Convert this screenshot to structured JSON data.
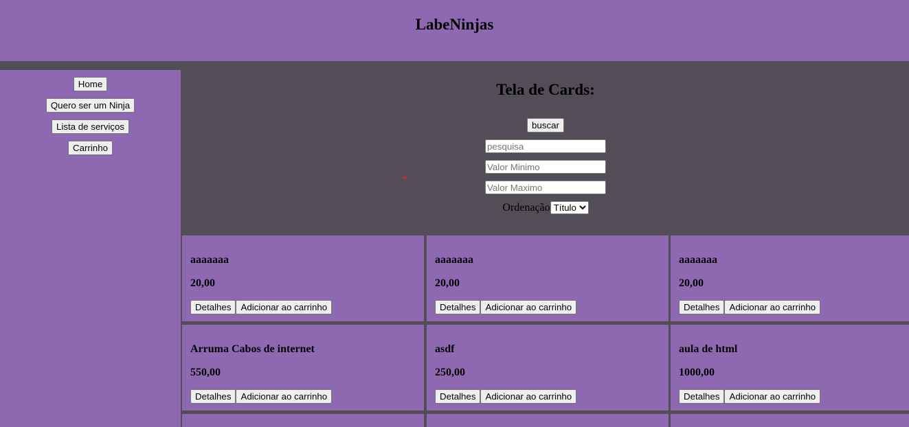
{
  "app": {
    "title": "LabeNinjas"
  },
  "sidebar": {
    "items": [
      {
        "label": "Home"
      },
      {
        "label": "Quero ser um Ninja"
      },
      {
        "label": "Lista de serviços"
      },
      {
        "label": "Carrinho"
      }
    ]
  },
  "filter": {
    "heading": "Tela de Cards:",
    "search_button": "buscar",
    "search_placeholder": "pesquisa",
    "min_placeholder": "Valor Minimo",
    "max_placeholder": "Valor Maximo",
    "sort_label": "Ordenação",
    "sort_selected": "Título"
  },
  "cards": [
    {
      "title": "aaaaaaa",
      "price": "20,00",
      "details_label": "Detalhes",
      "add_label": "Adicionar ao carrinho"
    },
    {
      "title": "aaaaaaa",
      "price": "20,00",
      "details_label": "Detalhes",
      "add_label": "Adicionar ao carrinho"
    },
    {
      "title": "aaaaaaa",
      "price": "20,00",
      "details_label": "Detalhes",
      "add_label": "Adicionar ao carrinho"
    },
    {
      "title": "Arruma Cabos de internet",
      "price": "550,00",
      "details_label": "Detalhes",
      "add_label": "Adicionar ao carrinho"
    },
    {
      "title": "asdf",
      "price": "250,00",
      "details_label": "Detalhes",
      "add_label": "Adicionar ao carrinho"
    },
    {
      "title": "aula de html",
      "price": "1000,00",
      "details_label": "Detalhes",
      "add_label": "Adicionar ao carrinho"
    },
    {
      "title": "",
      "price": "",
      "details_label": "",
      "add_label": ""
    },
    {
      "title": "",
      "price": "",
      "details_label": "",
      "add_label": ""
    },
    {
      "title": "",
      "price": "",
      "details_label": "",
      "add_label": ""
    }
  ],
  "colors": {
    "accent": "#8e69b2",
    "background": "#524d56"
  }
}
